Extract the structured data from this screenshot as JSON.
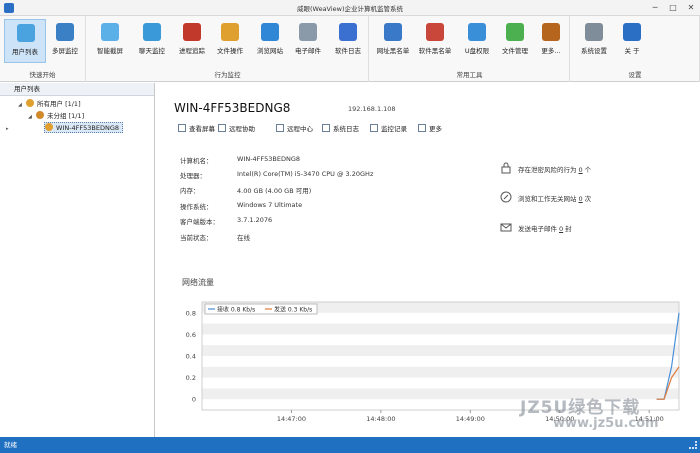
{
  "window": {
    "title": "威眼(WeaView)企业计算机监管系统",
    "minimize": "─",
    "maximize": "□",
    "close": "✕"
  },
  "ribbon": {
    "groups": [
      {
        "caption": "快速开始",
        "buttons": [
          {
            "label": "用户列表",
            "icon": "users-icon",
            "color": "#4aa3df",
            "active": true
          },
          {
            "label": "多屏监控",
            "icon": "monitors-icon",
            "color": "#3b7fc4",
            "active": false
          }
        ]
      },
      {
        "caption": "行为监控",
        "buttons": [
          {
            "label": "智能截屏",
            "icon": "screenshot-icon",
            "color": "#5bb0e8"
          },
          {
            "label": "聊天监控",
            "icon": "chat-icon",
            "color": "#3a9ad9"
          },
          {
            "label": "进程追踪",
            "icon": "briefcase-icon",
            "color": "#c0392b"
          },
          {
            "label": "文件操作",
            "icon": "folder-icon",
            "color": "#e0a030"
          },
          {
            "label": "浏览网站",
            "icon": "compass-icon",
            "color": "#2f87d6"
          },
          {
            "label": "电子邮件",
            "icon": "mail-icon",
            "color": "#8a9aa8"
          },
          {
            "label": "软件日志",
            "icon": "infinity-icon",
            "color": "#3b6fd0"
          }
        ]
      },
      {
        "caption": "常用工具",
        "buttons": [
          {
            "label": "网址黑名单",
            "icon": "web-blacklist-icon",
            "color": "#3a78c8"
          },
          {
            "label": "软件黑名单",
            "icon": "app-blacklist-icon",
            "color": "#c8463a"
          },
          {
            "label": "U盘权限",
            "icon": "usb-icon",
            "color": "#3a90d8"
          },
          {
            "label": "文件管理",
            "icon": "file-manage-icon",
            "color": "#4caf50"
          },
          {
            "label": "更多...",
            "icon": "toolbox-icon",
            "color": "#b5651d"
          }
        ]
      },
      {
        "caption": "设置",
        "buttons": [
          {
            "label": "系统设置",
            "icon": "gear-icon",
            "color": "#7f8c99"
          },
          {
            "label": "关 于",
            "icon": "info-icon",
            "color": "#2b6fc4"
          }
        ]
      }
    ]
  },
  "sidebar": {
    "header": "用户列表",
    "nodes": [
      {
        "label": "所有用户 [1/1]",
        "icon": "all-users-icon",
        "arrow": "◢"
      },
      {
        "label": "未分组 [1/1]",
        "icon": "group-icon",
        "arrow": "◢"
      },
      {
        "label": "WIN-4FF53BEDNG8",
        "icon": "user-icon",
        "arrow": "▸"
      }
    ]
  },
  "detail": {
    "computer_name": "WIN-4FF53BEDNG8",
    "ip": "192.168.1.108",
    "actions": [
      "查看屏幕",
      "远程协助",
      "远程中心",
      "系统日志",
      "监控记录",
      "更多"
    ],
    "info": [
      {
        "key": "计算机名：",
        "value": "WIN-4FF53BEDNG8"
      },
      {
        "key": "处理器：",
        "value": "Intel(R) Core(TM) i5-3470 CPU @ 3.20GHz"
      },
      {
        "key": "内存：",
        "value": "4.00 GB (4.00 GB 可用)"
      },
      {
        "key": "操作系统：",
        "value": "Windows 7 Ultimate"
      },
      {
        "key": "客户端版本：",
        "value": "3.7.1.2076"
      },
      {
        "key": "当前状态：",
        "value": "在线"
      }
    ],
    "risks": [
      {
        "pre": "存在泄密风险的行为",
        "count": "0",
        "unit": "个",
        "icon": "lock-icon"
      },
      {
        "pre": "浏览和工作无关网站",
        "count": "0",
        "unit": "次",
        "icon": "compass-icon"
      },
      {
        "pre": "发送电子邮件",
        "count": "0",
        "unit": "封",
        "icon": "mail-icon"
      }
    ]
  },
  "chart_data": {
    "type": "line",
    "title": "网络流量",
    "x_ticks": [
      "14:47:00",
      "14:48:00",
      "14:49:00",
      "14:50:00",
      "14:51:00"
    ],
    "ylim": [
      -0.1,
      0.9
    ],
    "y_ticks": [
      "0.8",
      "0.6",
      "0.4",
      "0.2",
      "0"
    ],
    "grid": true,
    "legend_position": "top-left",
    "series": [
      {
        "name": "接收 0.8 Kb/s",
        "color": "#4a90d9",
        "x": [
          "14:51:05",
          "14:51:10",
          "14:51:15",
          "14:51:20"
        ],
        "values": [
          0,
          0,
          0.3,
          0.8
        ]
      },
      {
        "name": "发送 0.3 Kb/s",
        "color": "#e07a3a",
        "x": [
          "14:51:05",
          "14:51:10",
          "14:51:15",
          "14:51:20"
        ],
        "values": [
          0,
          0,
          0.2,
          0.3
        ]
      }
    ]
  },
  "status": {
    "text": "就绪"
  },
  "watermark": {
    "line1": "JZ5U绿色下载",
    "line2": "www.jz5u.com"
  }
}
